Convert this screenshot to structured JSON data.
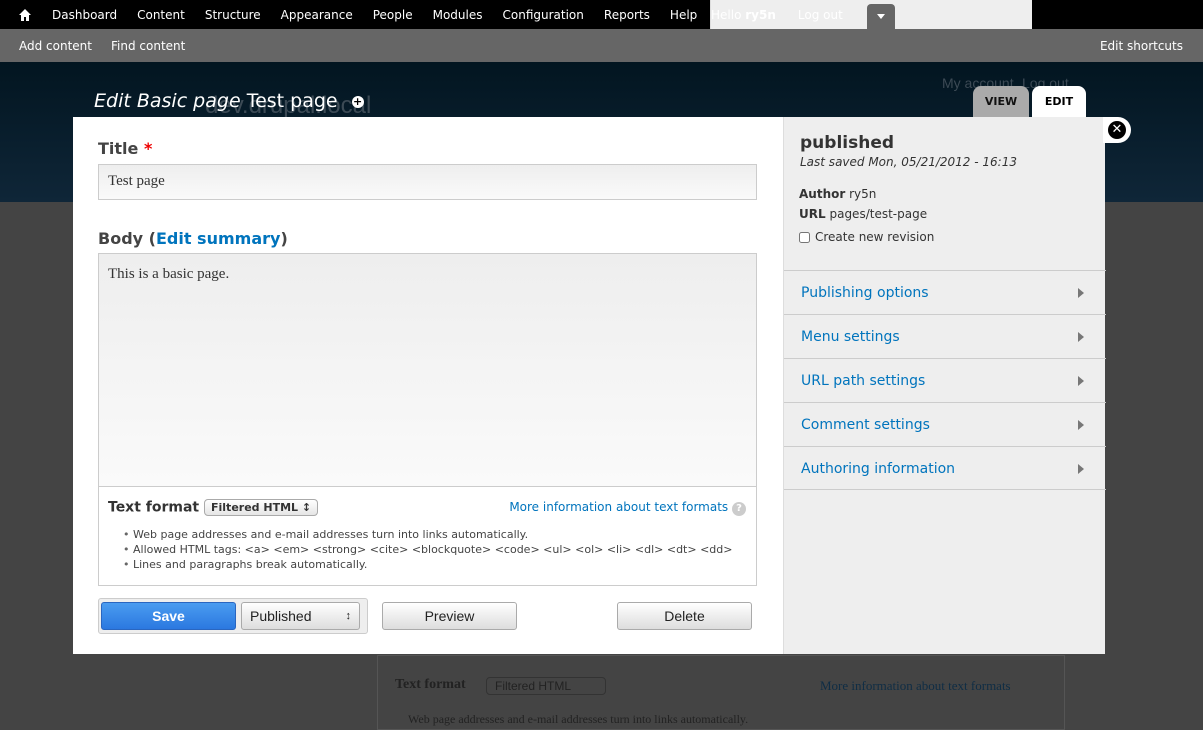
{
  "toolbar": {
    "items": [
      "Dashboard",
      "Content",
      "Structure",
      "Appearance",
      "People",
      "Modules",
      "Configuration",
      "Reports",
      "Help"
    ],
    "hello": "Hello",
    "user": "ry5n",
    "logout": "Log out"
  },
  "shortcuts": {
    "add": "Add content",
    "find": "Find content",
    "edit": "Edit shortcuts"
  },
  "background": {
    "my_account": "My account",
    "log_out": "Log out",
    "site_name": "dev.drupal.local",
    "text_format": "Text format",
    "format_value": "Filtered HTML",
    "more_info": "More information about text formats",
    "tip": "Web page addresses and e-mail addresses turn into links automatically."
  },
  "page": {
    "title_em": "Edit Basic page",
    "title": "Test page",
    "tabs": [
      "VIEW",
      "EDIT"
    ]
  },
  "form": {
    "title_label": "Title",
    "required": "*",
    "title_value": "Test page",
    "body_label": "Body",
    "edit_summary": "Edit summary",
    "body_value": "This is a basic page.",
    "text_format_label": "Text format",
    "format_value": "Filtered HTML",
    "more_info": "More information about text formats",
    "tips": [
      "Web page addresses and e-mail addresses turn into links automatically.",
      "Allowed HTML tags: <a> <em> <strong> <cite> <blockquote> <code> <ul> <ol> <li> <dl> <dt> <dd>",
      "Lines and paragraphs break automatically."
    ],
    "save": "Save",
    "status": "Published",
    "preview": "Preview",
    "delete": "Delete"
  },
  "sidebar": {
    "status": "published",
    "last_saved": "Last saved Mon, 05/21/2012 - 16:13",
    "author_label": "Author",
    "author": "ry5n",
    "url_label": "URL",
    "url": "pages/test-page",
    "revision": "Create new revision",
    "sections": [
      "Publishing options",
      "Menu settings",
      "URL path settings",
      "Comment settings",
      "Authoring information"
    ]
  }
}
